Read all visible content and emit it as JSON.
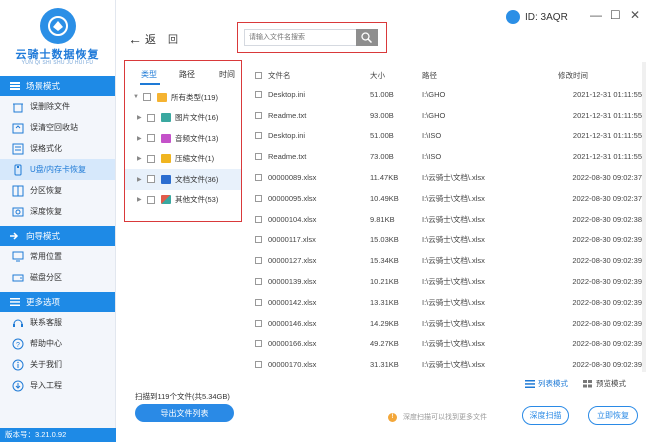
{
  "brand": {
    "title": "云骑士数据恢复",
    "subtitle": "YUN QI SHI SHU JU HUI FU",
    "version": "版本号：3.21.0.92"
  },
  "header": {
    "back_label": "返",
    "home_label": "回",
    "user_id": "ID: 3AQR",
    "minimize": "—",
    "restore": "☐",
    "close": "✕"
  },
  "search": {
    "placeholder": "请输入文件名搜索"
  },
  "sidebar": {
    "sections": [
      {
        "title": "场景模式",
        "items": [
          {
            "label": "误删除文件"
          },
          {
            "label": "误清空回收站"
          },
          {
            "label": "误格式化"
          },
          {
            "label": "U盘/内存卡恢复"
          },
          {
            "label": "分区恢复"
          },
          {
            "label": "深度恢复"
          }
        ]
      },
      {
        "title": "向导模式",
        "items": [
          {
            "label": "常用位置"
          },
          {
            "label": "磁盘分区"
          }
        ]
      },
      {
        "title": "更多选项",
        "items": [
          {
            "label": "联系客服"
          },
          {
            "label": "帮助中心"
          },
          {
            "label": "关于我们"
          },
          {
            "label": "导入工程"
          }
        ]
      }
    ]
  },
  "filter": {
    "tabs": [
      "类型",
      "路径",
      "时间"
    ],
    "tree": [
      {
        "label": "所有类型(119)",
        "icon": "folder-icon",
        "color": "#f5b331"
      },
      {
        "label": "图片文件(16)",
        "icon": "image-icon",
        "color": "#3aa8a0"
      },
      {
        "label": "音频文件(13)",
        "icon": "audio-icon",
        "color": "#c452c9"
      },
      {
        "label": "压缩文件(1)",
        "icon": "archive-icon",
        "color": "#f0b520"
      },
      {
        "label": "文档文件(36)",
        "icon": "document-icon",
        "color": "#2b6dd0"
      },
      {
        "label": "其他文件(53)",
        "icon": "other-icon",
        "color": "#e25b4a"
      }
    ]
  },
  "table": {
    "headers": {
      "name": "文件名",
      "size": "大小",
      "path": "路径",
      "time": "修改时间"
    },
    "rows": [
      {
        "name": "Desktop.ini",
        "size": "51.00B",
        "path": "I:\\GHO",
        "time": "2021-12-31 01:11:55"
      },
      {
        "name": "Readme.txt",
        "size": "93.00B",
        "path": "I:\\GHO",
        "time": "2021-12-31 01:11:55"
      },
      {
        "name": "Desktop.ini",
        "size": "51.00B",
        "path": "I:\\ISO",
        "time": "2021-12-31 01:11:55"
      },
      {
        "name": "Readme.txt",
        "size": "73.00B",
        "path": "I:\\ISO",
        "time": "2021-12-31 01:11:55"
      },
      {
        "name": "00000089.xlsx",
        "size": "11.47KB",
        "path": "I:\\云骑士\\文档\\.xlsx",
        "time": "2022-08-30 09:02:37"
      },
      {
        "name": "00000095.xlsx",
        "size": "10.49KB",
        "path": "I:\\云骑士\\文档\\.xlsx",
        "time": "2022-08-30 09:02:37"
      },
      {
        "name": "00000104.xlsx",
        "size": "9.81KB",
        "path": "I:\\云骑士\\文档\\.xlsx",
        "time": "2022-08-30 09:02:38"
      },
      {
        "name": "00000117.xlsx",
        "size": "15.03KB",
        "path": "I:\\云骑士\\文档\\.xlsx",
        "time": "2022-08-30 09:02:39"
      },
      {
        "name": "00000127.xlsx",
        "size": "15.34KB",
        "path": "I:\\云骑士\\文档\\.xlsx",
        "time": "2022-08-30 09:02:39"
      },
      {
        "name": "00000139.xlsx",
        "size": "10.21KB",
        "path": "I:\\云骑士\\文档\\.xlsx",
        "time": "2022-08-30 09:02:39"
      },
      {
        "name": "00000142.xlsx",
        "size": "13.31KB",
        "path": "I:\\云骑士\\文档\\.xlsx",
        "time": "2022-08-30 09:02:39"
      },
      {
        "name": "00000146.xlsx",
        "size": "14.29KB",
        "path": "I:\\云骑士\\文档\\.xlsx",
        "time": "2022-08-30 09:02:39"
      },
      {
        "name": "00000166.xlsx",
        "size": "49.27KB",
        "path": "I:\\云骑士\\文档\\.xlsx",
        "time": "2022-08-30 09:02:39"
      },
      {
        "name": "00000170.xlsx",
        "size": "31.31KB",
        "path": "I:\\云骑士\\文档\\.xlsx",
        "time": "2022-08-30 09:02:39"
      }
    ]
  },
  "bottom": {
    "list_mode": "列表模式",
    "preview_mode": "预览模式",
    "scan_info": "扫描到119个文件(共5.34GB)",
    "export_label": "导出文件列表",
    "tip": "深度扫描可以找到更多文件",
    "deep_scan_label": "深度扫描",
    "recover_label": "立即恢复"
  },
  "colors": {
    "accent": "#1e8ae6",
    "highlight": "#d9393a"
  }
}
